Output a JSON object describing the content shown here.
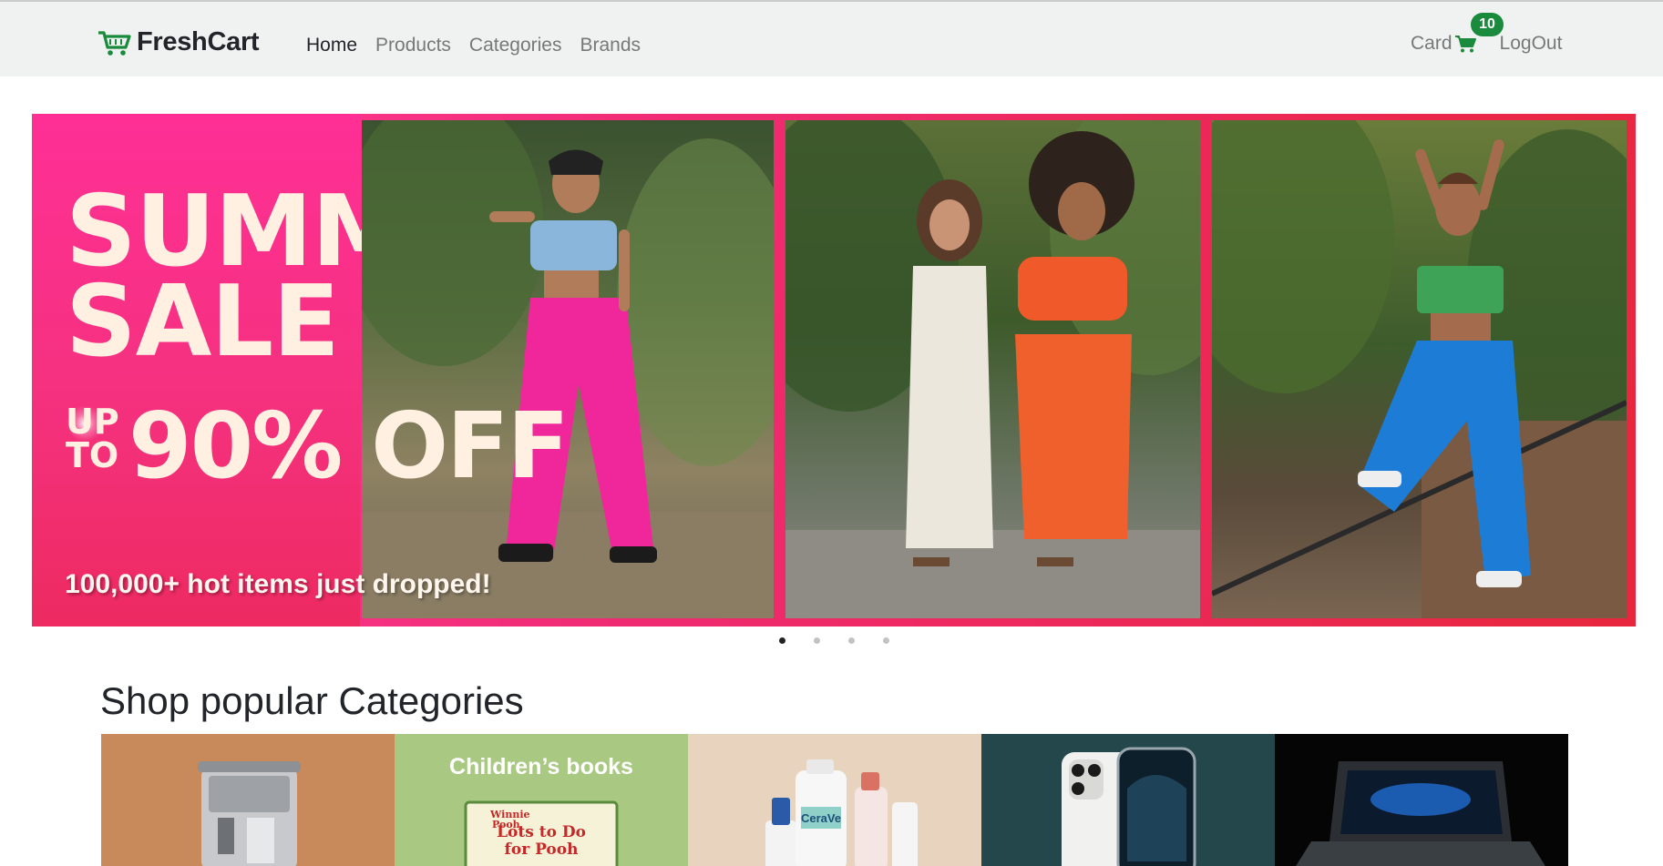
{
  "nav": {
    "brand": "FreshCart",
    "links": [
      {
        "label": "Home",
        "active": true
      },
      {
        "label": "Products",
        "active": false
      },
      {
        "label": "Categories",
        "active": false
      },
      {
        "label": "Brands",
        "active": false
      }
    ],
    "cart_label": "Card",
    "cart_count": "10",
    "logout_label": "LogOut",
    "brand_color": "#1a8a3c"
  },
  "hero": {
    "title_line1": "SUMMER",
    "title_line2": "SALE",
    "upto_line1": "UP",
    "upto_line2": "TO",
    "percent": "90% OFF",
    "subtitle": "100,000+ hot items just dropped!",
    "slides": 4,
    "active_slide": 1
  },
  "categories": {
    "title": "Shop popular Categories",
    "items": [
      {
        "name": "coffee-machine",
        "caption": ""
      },
      {
        "name": "childrens-books",
        "caption": "Children’s books"
      },
      {
        "name": "skincare",
        "caption": ""
      },
      {
        "name": "smartphone",
        "caption": ""
      },
      {
        "name": "laptop",
        "caption": ""
      }
    ]
  }
}
